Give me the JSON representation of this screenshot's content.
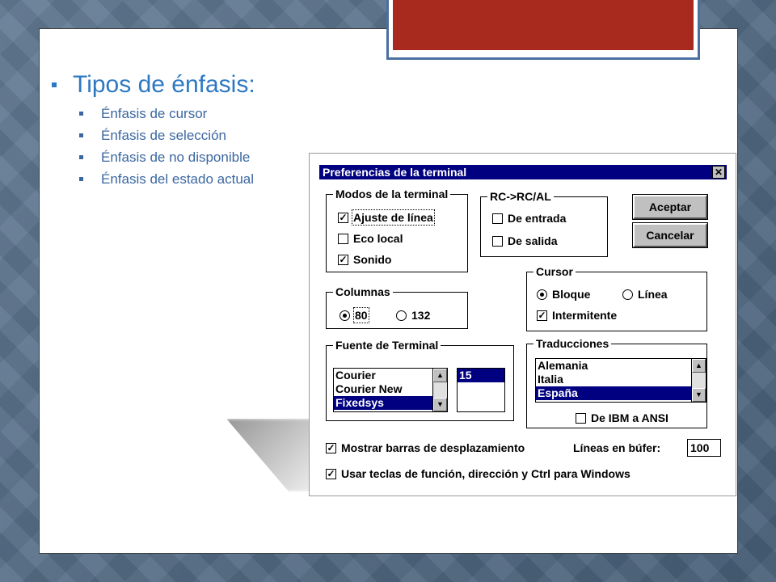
{
  "slide": {
    "heading": "Tipos de énfasis:",
    "items": [
      "Énfasis de cursor",
      "Énfasis de selección",
      "Énfasis de no disponible",
      "Énfasis del estado actual"
    ]
  },
  "dialog": {
    "title": "Preferencias de la terminal",
    "close_glyph": "✕",
    "modos": {
      "label": "Modos de la terminal",
      "ajuste": "Ajuste de línea",
      "eco": "Eco local",
      "sonido": "Sonido"
    },
    "rc": {
      "label": "RC->RC/AL",
      "entrada": "De entrada",
      "salida": "De salida"
    },
    "buttons": {
      "aceptar": "Aceptar",
      "cancelar": "Cancelar"
    },
    "cursor": {
      "label": "Cursor",
      "bloque": "Bloque",
      "linea": "Línea",
      "intermitente": "Intermitente"
    },
    "columnas": {
      "label": "Columnas",
      "c80": "80",
      "c132": "132"
    },
    "fuente": {
      "label": "Fuente de Terminal",
      "fonts": [
        "Courier",
        "Courier New",
        "Fixedsys"
      ],
      "size": "15"
    },
    "traducciones": {
      "label": "Traducciones",
      "items": [
        "Alemania",
        "Italia",
        "España"
      ],
      "ibm_ansi": "De IBM a ANSI"
    },
    "mostrar_barras": "Mostrar barras de desplazamiento",
    "lineas_bufer": {
      "label": "Líneas en búfer:",
      "value": "100"
    },
    "usar_teclas": "Usar teclas de función, dirección y Ctrl para Windows",
    "check_glyph": "✓",
    "arrow_up": "▲",
    "arrow_down": "▼"
  }
}
